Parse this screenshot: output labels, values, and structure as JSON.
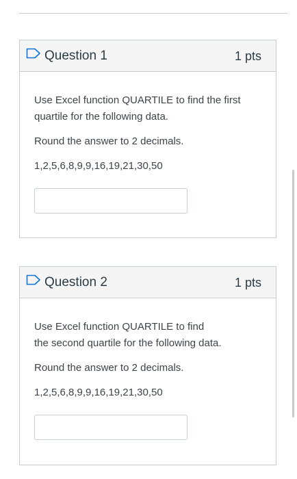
{
  "questions": [
    {
      "title": "Question 1",
      "points": "1 pts",
      "prompt": "Use Excel function QUARTILE to find the first\nquartile for the following data.",
      "instruction": "Round the answer to 2 decimals.",
      "data_values": "1,2,5,6,8,9,9,16,19,21,30,50",
      "answer_value": ""
    },
    {
      "title": "Question 2",
      "points": "1 pts",
      "prompt": "Use Excel function QUARTILE to find\nthe second quartile for the following data.",
      "instruction": "Round the answer to 2 decimals.",
      "data_values": "1,2,5,6,8,9,9,16,19,21,30,50",
      "answer_value": ""
    }
  ],
  "colors": {
    "border": "#c7cdd1",
    "header_bg": "#f5f5f5",
    "flag_blue": "#0b74d8",
    "text": "#2d3b45"
  }
}
